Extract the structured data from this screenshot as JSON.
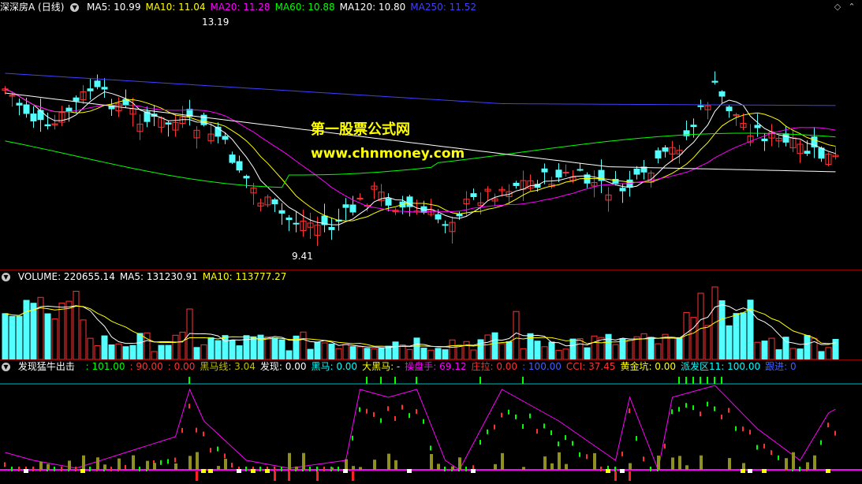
{
  "price_panel": {
    "stock_label": "深深房A (日线)",
    "indicators": [
      {
        "text": "MA5: 10.99",
        "color": "#ffffff"
      },
      {
        "text": "MA10: 11.04",
        "color": "#ffff00"
      },
      {
        "text": "MA20: 11.28",
        "color": "#ff00ff"
      },
      {
        "text": "MA60: 10.88",
        "color": "#00ff00"
      },
      {
        "text": "MA120: 10.80",
        "color": "#ffffff"
      },
      {
        "text": "MA250: 11.52",
        "color": "#4040ff"
      }
    ],
    "high_label": "13.19",
    "low_label": "9.41",
    "watermark_title": "第一股票公式网",
    "watermark_url": "www.chnmoney.com"
  },
  "volume_panel": {
    "indicators": [
      {
        "text": "VOLUME: 220655.14",
        "color": "#ffffff"
      },
      {
        "text": "MA5: 131230.91",
        "color": "#ffffff"
      },
      {
        "text": "MA10: 113777.27",
        "color": "#ffff00"
      }
    ]
  },
  "signal_panel": {
    "title": "发现猛牛出击",
    "indicators": [
      {
        "text": ": 101.00",
        "color": "#00ff00"
      },
      {
        "text": ": 90.00",
        "color": "#ff3030"
      },
      {
        "text": ": 0.00",
        "color": "#ff3030"
      },
      {
        "text": "黑马线: 3.04",
        "color": "#c0c000"
      },
      {
        "text": "发现: 0.00",
        "color": "#ffffff"
      },
      {
        "text": "黑马: 0.00",
        "color": "#00ffff"
      },
      {
        "text": "大黑马: -",
        "color": "#ffff00"
      },
      {
        "text": "操盘手: 69.12",
        "color": "#ff00ff"
      },
      {
        "text": "庄拉: 0.00",
        "color": "#ff3030"
      },
      {
        "text": ": 100.00",
        "color": "#4060ff"
      },
      {
        "text": "CCI: 37.45",
        "color": "#ff3030"
      },
      {
        "text": "黄金坑: 0.00",
        "color": "#ffff00"
      },
      {
        "text": "派发区11: 100.00",
        "color": "#00ffff"
      },
      {
        "text": "跟进: 0",
        "color": "#4060ff"
      }
    ]
  },
  "colors": {
    "up": "#ff3232",
    "down": "#54ffff",
    "separator": "#8b0000"
  }
}
